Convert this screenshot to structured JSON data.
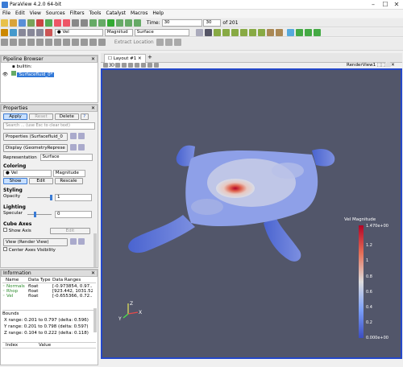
{
  "window": {
    "title": "ParaView 4.2.0 64-bit"
  },
  "menu": [
    "File",
    "Edit",
    "View",
    "Sources",
    "Filters",
    "Tools",
    "Catalyst",
    "Macros",
    "Help"
  ],
  "toolbar": {
    "time_label": "Time:",
    "time_value": "30",
    "frame_value": "30",
    "frame_of": "of 201",
    "array": "Vel",
    "component": "Magnitud",
    "representation": "Surface",
    "extract_location": "Extract Location"
  },
  "pipeline": {
    "title": "Pipeline Browser",
    "root": "builtin:",
    "source": "Surfacefluid_0*"
  },
  "properties": {
    "title": "Properties",
    "apply": "Apply",
    "reset": "Reset",
    "delete": "Delete",
    "help": "?",
    "search_placeholder": "Search ... (use Esc to clear text)",
    "props_section": "Properties (Surfacefluid_0",
    "display_section": "Display (GeometryReprese",
    "representation_label": "Representation",
    "representation_value": "Surface",
    "coloring": "Coloring",
    "color_array": "Vel",
    "color_mode": "Magnitude",
    "show": "Show",
    "edit": "Edit",
    "rescale": "Rescale",
    "styling": "Styling",
    "opacity_label": "Opacity",
    "opacity_value": "1",
    "lighting": "Lighting",
    "specular_label": "Specular",
    "specular_value": "0",
    "cube_axes": "Cube Axes",
    "show_axis": "Show Axis",
    "edit2": "Edit",
    "view_section": "View (Render View)",
    "center_axes": "Center Axes Visibility"
  },
  "information": {
    "title": "Information",
    "columns": [
      "Name",
      "Data Type",
      "Data Ranges"
    ],
    "rows": [
      {
        "name": "Normals",
        "type": "float",
        "range": "[-0.973854, 0.97..."
      },
      {
        "name": "Rhop",
        "type": "float",
        "range": "[923.442, 1031.52]"
      },
      {
        "name": "Vel",
        "type": "float",
        "range": "[-0.655366, 0.72..."
      }
    ],
    "bounds_label": "Bounds",
    "x_range": "X range:  0.201 to 0.797 (delta: 0.596)",
    "y_range": "Y range:  0.201 to 0.798 (delta: 0.597)",
    "z_range": "Z range:  0.104 to 0.222 (delta: 0.118)",
    "index_col": "Index",
    "value_col": "Value"
  },
  "layout": {
    "tab": "Layout #1",
    "add_tab": "+",
    "view_name": "RenderView1",
    "buttons": [
      "3D"
    ]
  },
  "colorbar": {
    "title": "Vel Magnitude",
    "labels": [
      "1.470e+00",
      "1.2",
      "1",
      "0.8",
      "0.6",
      "0.4",
      "0.2",
      "0.000e+00"
    ],
    "top_color": "#b40426",
    "mid_color": "#dddddd",
    "bottom_color": "#3b4cc0"
  },
  "axes": {
    "x": "X",
    "y": "Y",
    "z": "Z"
  }
}
